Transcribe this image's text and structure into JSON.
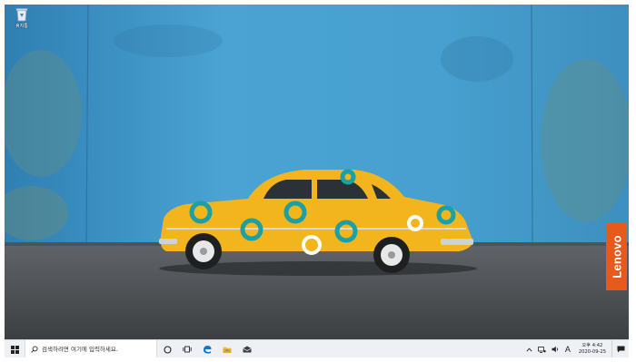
{
  "desktop": {
    "icons": [
      {
        "label": "휴지통",
        "icon": "recycle-bin-icon"
      }
    ],
    "brand_badge": "Lenovo"
  },
  "taskbar": {
    "search": {
      "placeholder": "검색하려면 여기에 입력하세요."
    },
    "pinned": [
      {
        "name": "cortana",
        "icon": "cortana-circle-icon"
      },
      {
        "name": "task-view",
        "icon": "task-view-icon"
      },
      {
        "name": "edge",
        "icon": "edge-icon"
      },
      {
        "name": "file-explorer",
        "icon": "folder-icon"
      },
      {
        "name": "mail",
        "icon": "mail-icon"
      }
    ],
    "tray": {
      "ime_indicator": "A",
      "time": "오후 4:42",
      "date": "2020-09-25"
    }
  },
  "colors": {
    "wall": "#3b8fc4",
    "car": "#f2b51d",
    "badge": "#e85a1c",
    "taskbar": "#eef0f3"
  }
}
